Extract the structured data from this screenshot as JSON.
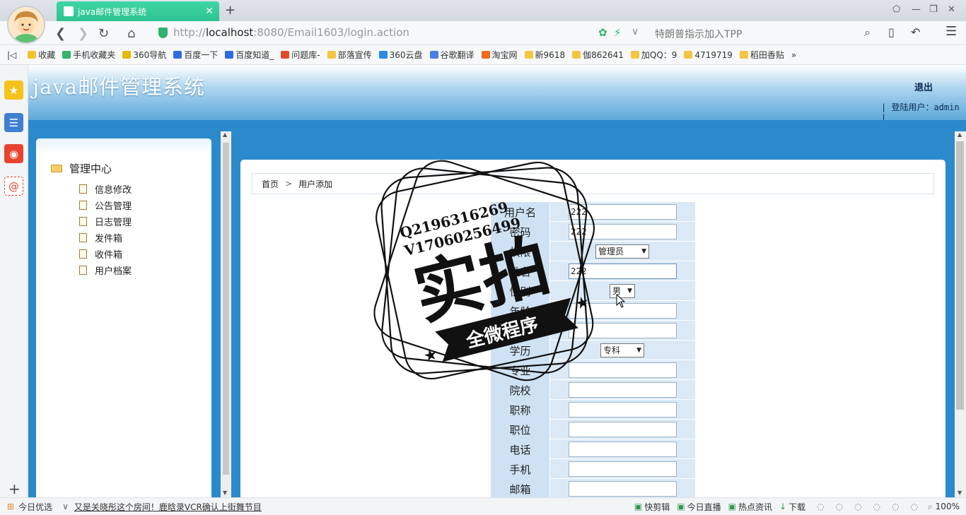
{
  "browser": {
    "tab_title": "java邮件管理系统",
    "url_prefix": "http://",
    "url_host": "localhost",
    "url_rest": ":8080/Email1603/login.action",
    "search_hint": "特朗普指示加入TPP"
  },
  "bookmarks": [
    {
      "label": "收藏",
      "color": "#f2c230"
    },
    {
      "label": "手机收藏夹",
      "color": "#35b36b"
    },
    {
      "label": "360导航",
      "color": "#e6b800"
    },
    {
      "label": "百度一下",
      "color": "#2e6de0"
    },
    {
      "label": "百度知道_",
      "color": "#2e6de0"
    },
    {
      "label": "问题库-",
      "color": "#e24a2c"
    },
    {
      "label": "部落宣传",
      "color": "#f5c542"
    },
    {
      "label": "360云盘",
      "color": "#2d8be6"
    },
    {
      "label": "谷歌翻译",
      "color": "#4a7ee8"
    },
    {
      "label": "淘宝网",
      "color": "#f06a1c"
    },
    {
      "label": "新9618",
      "color": "#f5c542"
    },
    {
      "label": "伽862641",
      "color": "#f5c542"
    },
    {
      "label": "加QQ：9",
      "color": "#f5c542"
    },
    {
      "label": "4719719",
      "color": "#f5c542"
    },
    {
      "label": "稻田香贴",
      "color": "#f5c542"
    }
  ],
  "header": {
    "title": "java邮件管理系统",
    "logout": "退出",
    "login_user": "| 登陆用户：admin |"
  },
  "menu": {
    "root": "管理中心",
    "items": [
      "信息修改",
      "公告管理",
      "日志管理",
      "发件箱",
      "收件箱",
      "用户档案"
    ]
  },
  "breadcrumb": {
    "home": "首页",
    "current": "用户添加"
  },
  "form": {
    "rows": [
      {
        "label": "用户名",
        "type": "text",
        "value": "222"
      },
      {
        "label": "密码",
        "type": "text",
        "value": "222"
      },
      {
        "label": "权限",
        "type": "select",
        "value": "管理员"
      },
      {
        "label": "姓名",
        "type": "text",
        "value": "222"
      },
      {
        "label": "性别",
        "type": "select",
        "value": "男"
      },
      {
        "label": "年龄",
        "type": "text",
        "value": ""
      },
      {
        "label": "民族",
        "type": "text",
        "value": ""
      },
      {
        "label": "学历",
        "type": "select",
        "value": "专科"
      },
      {
        "label": "专业",
        "type": "text",
        "value": ""
      },
      {
        "label": "院校",
        "type": "text",
        "value": ""
      },
      {
        "label": "职称",
        "type": "text",
        "value": ""
      },
      {
        "label": "职位",
        "type": "text",
        "value": ""
      },
      {
        "label": "电话",
        "type": "text",
        "value": ""
      },
      {
        "label": "手机",
        "type": "text",
        "value": ""
      },
      {
        "label": "邮箱",
        "type": "text",
        "value": ""
      }
    ]
  },
  "watermark": {
    "line1": "Q2196316269",
    "line2": "V17060256499",
    "big": "实拍",
    "banner": "全微程序"
  },
  "statusbar": {
    "left": "今日优选",
    "news": "又是关晓彤这个房间！鹿晗录VCR确认上街舞节目",
    "items": [
      "快剪辑",
      "今日直播",
      "热点资讯",
      "下载"
    ],
    "zoom": "100%"
  },
  "colors": {
    "accent": "#2b8acb",
    "tab": "#2fc392",
    "label_bg": "#cfe2f3"
  }
}
